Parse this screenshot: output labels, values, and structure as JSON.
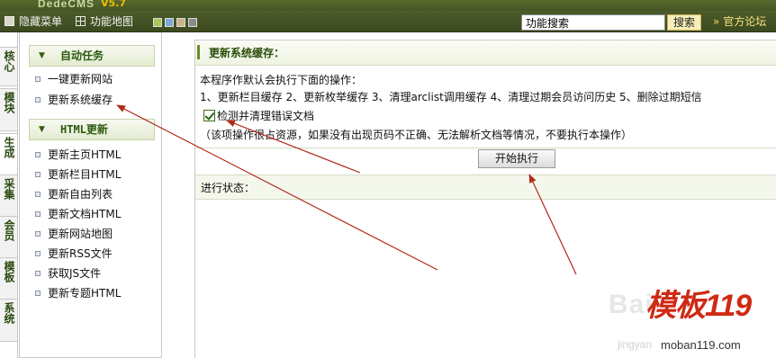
{
  "brand": {
    "logo_text": "DedeCMS",
    "version": "V5.7"
  },
  "toolbar": {
    "hide_menu_label": "隐藏菜单",
    "function_map_label": "功能地图",
    "skin_colors": [
      "#a7c957",
      "#7fa8d6",
      "#c9b48b",
      "#8a8a8a"
    ],
    "search_value": "功能搜索",
    "search_button_label": "搜索",
    "forum_label": "官方论坛"
  },
  "vertical_tabs": [
    {
      "label": "核心"
    },
    {
      "label": "模块"
    },
    {
      "label": "生成"
    },
    {
      "label": "采集"
    },
    {
      "label": "会员"
    },
    {
      "label": "模板"
    },
    {
      "label": "系统"
    }
  ],
  "sidebar": {
    "auto_tasks": {
      "title": "自动任务",
      "items": [
        {
          "label": "一键更新网站"
        },
        {
          "label": "更新系统缓存"
        }
      ]
    },
    "html_update": {
      "title_prefix": "HTML",
      "title_suffix": "更新",
      "items": [
        {
          "label": "更新主页HTML"
        },
        {
          "label": "更新栏目HTML"
        },
        {
          "label": "更新自由列表"
        },
        {
          "label": "更新文档HTML"
        },
        {
          "label": "更新网站地图"
        },
        {
          "label": "更新RSS文件"
        },
        {
          "label": "获取JS文件"
        },
        {
          "label": "更新专题HTML"
        }
      ]
    }
  },
  "main": {
    "title": "更新系统缓存：",
    "description": "本程序作默认会执行下面的操作：",
    "steps": "1、更新栏目缓存 2、更新枚举缓存 3、清理arclist调用缓存 4、清理过期会员访问历史 5、删除过期短信",
    "checkbox_label": "检测并清理错误文档",
    "checkbox_checked": true,
    "note": "（该项操作很占资源，如果没有出现页码不正确、无法解析文档等情况，不要执行本操作）",
    "run_button_label": "开始执行",
    "status_label": "进行状态："
  },
  "annotations": {
    "arrow_color": "#b22a1a"
  },
  "watermark": {
    "baidu_text": "Bai",
    "logo_text": "模板119",
    "site": "moban119.com",
    "jingyan": "jingyan"
  }
}
